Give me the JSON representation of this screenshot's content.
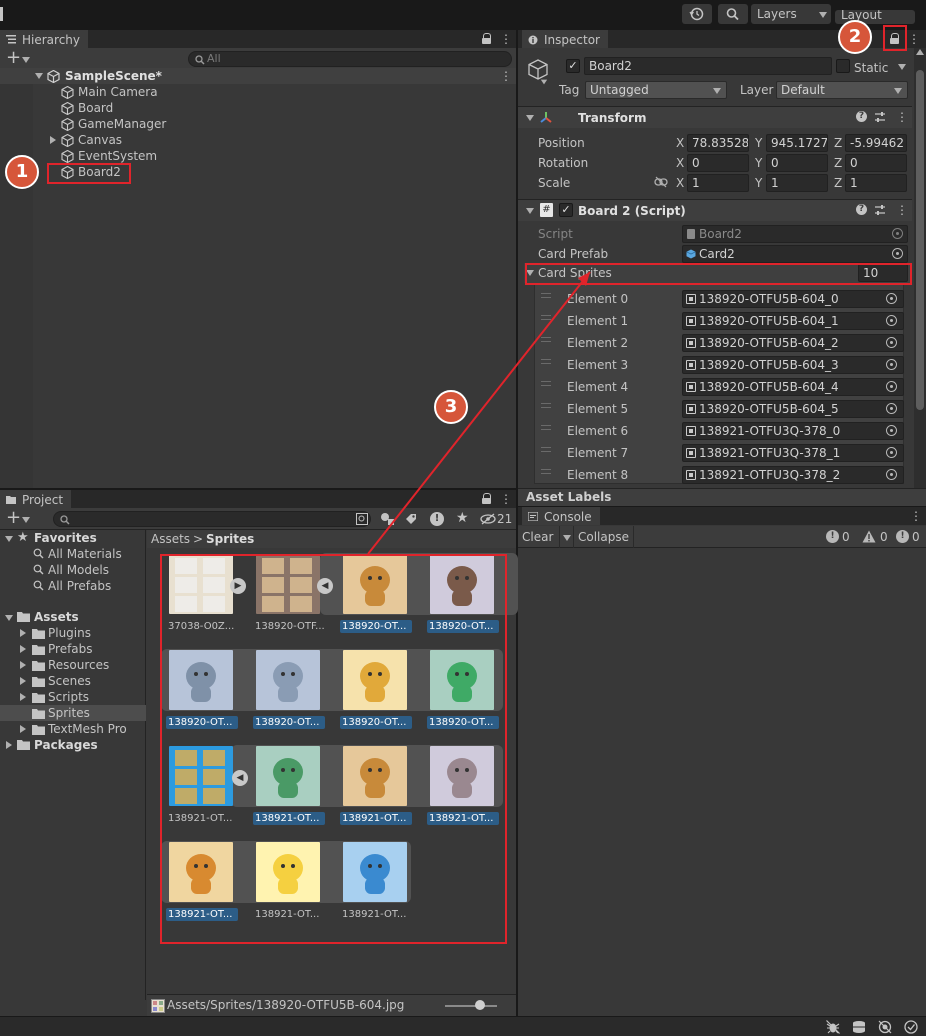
{
  "toolbar": {
    "layers": "Layers",
    "layout": "Layout",
    "history_icon": "history-icon",
    "search_icon": "search-icon"
  },
  "hierarchy": {
    "tab": "Hierarchy",
    "search_placeholder": "All",
    "scene": "SampleScene*",
    "items": [
      {
        "label": "Main Camera"
      },
      {
        "label": "Board"
      },
      {
        "label": "GameManager"
      },
      {
        "label": "Canvas"
      },
      {
        "label": "EventSystem"
      },
      {
        "label": "Board2"
      }
    ]
  },
  "inspector": {
    "tab": "Inspector",
    "object_name": "Board2",
    "static_label": "Static",
    "tag_label": "Tag",
    "tag_value": "Untagged",
    "layer_label": "Layer",
    "layer_value": "Default",
    "transform": {
      "title": "Transform",
      "position_label": "Position",
      "rotation_label": "Rotation",
      "scale_label": "Scale",
      "position": {
        "x": "78.83528",
        "y": "945.1727",
        "z": "-5.99462"
      },
      "rotation": {
        "x": "0",
        "y": "0",
        "z": "0"
      },
      "scale": {
        "x": "1",
        "y": "1",
        "z": "1"
      },
      "x": "X",
      "y": "Y",
      "z": "Z"
    },
    "script_comp": {
      "title": "Board 2 (Script)",
      "script_label": "Script",
      "script_value": "Board2",
      "card_prefab_label": "Card Prefab",
      "card_prefab_value": "Card2",
      "card_sprites_label": "Card Sprites",
      "card_sprites_count": "10",
      "elements": [
        {
          "label": "Element 0",
          "value": "138920-OTFU5B-604_0"
        },
        {
          "label": "Element 1",
          "value": "138920-OTFU5B-604_1"
        },
        {
          "label": "Element 2",
          "value": "138920-OTFU5B-604_2"
        },
        {
          "label": "Element 3",
          "value": "138920-OTFU5B-604_3"
        },
        {
          "label": "Element 4",
          "value": "138920-OTFU5B-604_4"
        },
        {
          "label": "Element 5",
          "value": "138920-OTFU5B-604_5"
        },
        {
          "label": "Element 6",
          "value": "138921-OTFU3Q-378_0"
        },
        {
          "label": "Element 7",
          "value": "138921-OTFU3Q-378_1"
        },
        {
          "label": "Element 8",
          "value": "138921-OTFU3Q-378_2"
        }
      ]
    },
    "asset_labels": "Asset Labels"
  },
  "project": {
    "tab": "Project",
    "hidden_count": "21",
    "breadcrumb_root": "Assets",
    "breadcrumb_leaf": "Sprites",
    "tree": {
      "favorites": "Favorites",
      "fav_items": [
        "All Materials",
        "All Models",
        "All Prefabs"
      ],
      "assets": "Assets",
      "asset_folders": [
        "Plugins",
        "Prefabs",
        "Resources",
        "Scenes",
        "Scripts",
        "Sprites",
        "TextMesh Pro"
      ],
      "packages": "Packages"
    },
    "grid": [
      {
        "label": "37038-O0Z...",
        "selected": false
      },
      {
        "label": "138920-OTF...",
        "selected": false
      },
      {
        "label": "138920-OT...",
        "selected": true
      },
      {
        "label": "138920-OT...",
        "selected": true
      },
      {
        "label": "138920-OT...",
        "selected": true
      },
      {
        "label": "138920-OT...",
        "selected": true
      },
      {
        "label": "138920-OT...",
        "selected": true
      },
      {
        "label": "138920-OT...",
        "selected": true
      },
      {
        "label": "138921-OT...",
        "selected": false
      },
      {
        "label": "138921-OT...",
        "selected": true
      },
      {
        "label": "138921-OT...",
        "selected": true
      },
      {
        "label": "138921-OT...",
        "selected": true
      },
      {
        "label": "138921-OT...",
        "selected": true
      },
      {
        "label": "138921-OT...",
        "selected": false
      },
      {
        "label": "138921-OT...",
        "selected": false
      }
    ],
    "status_path": "Assets/Sprites/138920-OTFU5B-604.jpg"
  },
  "console": {
    "tab": "Console",
    "clear": "Clear",
    "collapse": "Collapse",
    "info_count": "0",
    "warn_count": "0",
    "error_count": "0"
  },
  "annotations": {
    "b1": "1",
    "b2": "2",
    "b3": "3"
  },
  "colors": {
    "accent_red": "#e0242b",
    "badge": "#d6563a",
    "selection": "#2c5d87"
  }
}
